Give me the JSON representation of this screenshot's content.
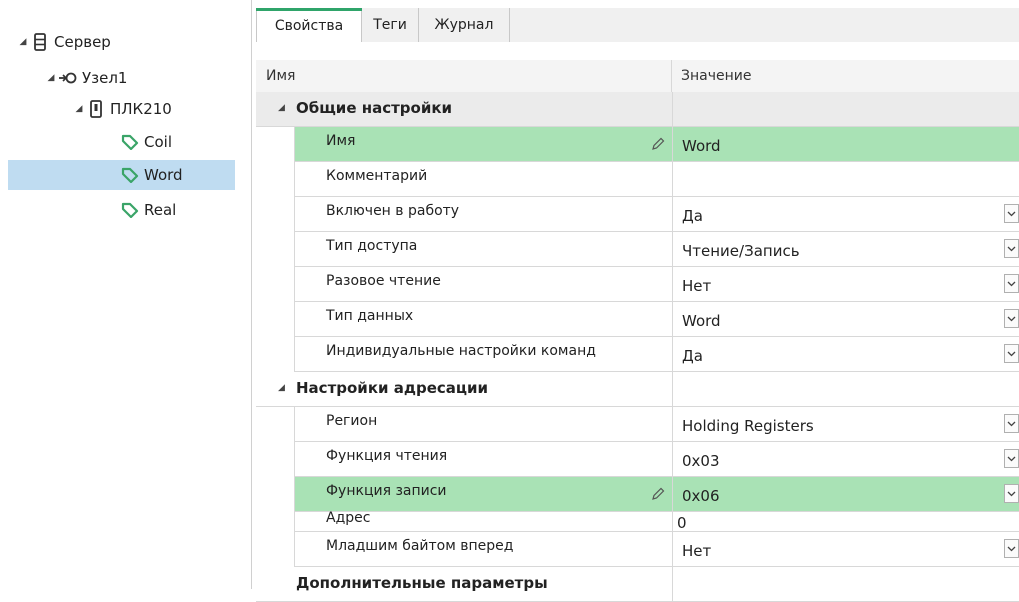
{
  "tree": {
    "server": "Сервер",
    "node": "Узел1",
    "plc": "ПЛК210",
    "tags": [
      "Coil",
      "Word",
      "Real"
    ],
    "selected_tag": "Word"
  },
  "tabs": [
    "Свойства",
    "Теги",
    "Журнал"
  ],
  "active_tab": "Свойства",
  "grid": {
    "col_name": "Имя",
    "col_value": "Значение",
    "cat_general": "Общие настройки",
    "general": [
      {
        "name": "Имя",
        "value": "Word",
        "editable": true,
        "highlighted": true
      },
      {
        "name": "Комментарий",
        "value": ""
      },
      {
        "name": "Включен в работу",
        "value": "Да",
        "dropdown": true
      },
      {
        "name": "Тип доступа",
        "value": "Чтение/Запись",
        "dropdown": true
      },
      {
        "name": "Разовое чтение",
        "value": "Нет",
        "dropdown": true
      },
      {
        "name": "Тип данных",
        "value": "Word",
        "dropdown": true
      },
      {
        "name": "Индивидуальные настройки команд",
        "value": "Да",
        "dropdown": true
      }
    ],
    "cat_addressing": "Настройки адресации",
    "addressing": [
      {
        "name": "Регион",
        "value": "Holding Registers",
        "dropdown": true
      },
      {
        "name": "Функция чтения",
        "value": "0x03",
        "dropdown": true
      },
      {
        "name": "Функция записи",
        "value": "0x06",
        "dropdown": true,
        "editable": true,
        "highlighted": true
      },
      {
        "name": "Адрес",
        "value": "0"
      },
      {
        "name": "Младшим байтом вперед",
        "value": "Нет",
        "dropdown": true
      }
    ],
    "cat_extra": "Дополнительные параметры"
  },
  "colors": {
    "highlight": "#a9e2b5",
    "selection": "#bfdcf1",
    "tab_accent": "#2fa46a"
  }
}
